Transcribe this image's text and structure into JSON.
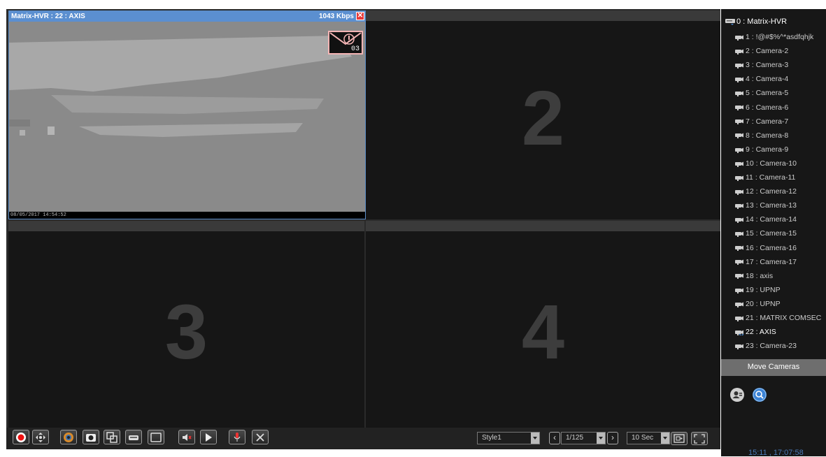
{
  "window": {
    "accent_color": "#5b8fd0"
  },
  "tiles": [
    {
      "title": "Matrix-HVR : 22 : AXIS",
      "bitrate": "1043 Kbps",
      "timestamp": "08/05/2017 14:54:52",
      "event_count": "03"
    },
    {
      "number": "2"
    },
    {
      "number": "3"
    },
    {
      "number": "4"
    }
  ],
  "toolbar": {
    "buttons": [
      "record-icon",
      "ptz-icon",
      "color-adjust-icon",
      "snapshot-icon",
      "zoom-window-icon",
      "device-icon",
      "single-layout-icon",
      "mute-icon",
      "play-icon",
      "microphone-icon",
      "close-icon"
    ],
    "style_value": "Style1",
    "page_value": "1/125",
    "interval_value": "10 Sec"
  },
  "sidebar": {
    "root": "0 : Matrix-HVR",
    "cameras": [
      "1 : !@#$%^*asdfqhjk",
      "2 : Camera-2",
      "3 : Camera-3",
      "4 : Camera-4",
      "5 : Camera-5",
      "6 : Camera-6",
      "7 : Camera-7",
      "8 : Camera-8",
      "9 : Camera-9",
      "10 : Camera-10",
      "11 : Camera-11",
      "12 : Camera-12",
      "13 : Camera-13",
      "14 : Camera-14",
      "15 : Camera-15",
      "16 : Camera-16",
      "17 : Camera-17",
      "18 : axis",
      "19 : UPNP",
      "20 : UPNP",
      "21 : MATRIX COMSEC",
      "22 : AXIS",
      "23 : Camera-23"
    ],
    "selected_index": 21,
    "move_cameras_label": "Move Cameras"
  },
  "status": {
    "clock": "15:11 , 17:07:58"
  }
}
